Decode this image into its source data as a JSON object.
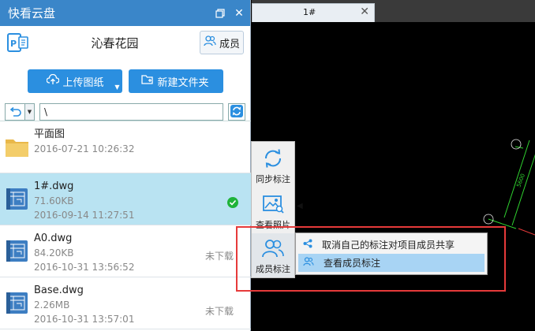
{
  "app": {
    "title": "快看云盘"
  },
  "project": {
    "name": "沁春花园",
    "members_label": "成员"
  },
  "actions": {
    "upload_label": "上传图纸",
    "new_folder_label": "新建文件夹"
  },
  "pathbar": {
    "path_value": "\\"
  },
  "files": [
    {
      "name": "平面图",
      "meta1": "2016-07-21 10:26:32",
      "meta2": "",
      "status": "",
      "type": "folder-icon"
    },
    {
      "name": "1#.dwg",
      "meta1": "71.60KB",
      "meta2": "2016-09-14 11:27:51",
      "status": "",
      "type": "dwg-icon",
      "selected": true,
      "downloaded": true
    },
    {
      "name": "A0.dwg",
      "meta1": "84.20KB",
      "meta2": "2016-10-31 13:56:52",
      "status": "未下载",
      "type": "dwg-icon"
    },
    {
      "name": "Base.dwg",
      "meta1": "2.26MB",
      "meta2": "2016-10-31 13:57:01",
      "status": "未下载",
      "type": "dwg-icon"
    }
  ],
  "tab": {
    "label": "1#",
    "close": "✕"
  },
  "sidetool": {
    "sync_label": "同步标注",
    "photos_label": "查看照片",
    "members_label": "成员标注"
  },
  "context_menu": {
    "item1": "取消自己的标注对项目成员共享",
    "item2": "查看成员标注"
  },
  "colors": {
    "title_bar": "#3a86c9",
    "accent": "#2b8fe0",
    "selected_row": "#b9e3f2",
    "highlight_box": "#e63a3a",
    "cad_line": "#2fd22f"
  }
}
